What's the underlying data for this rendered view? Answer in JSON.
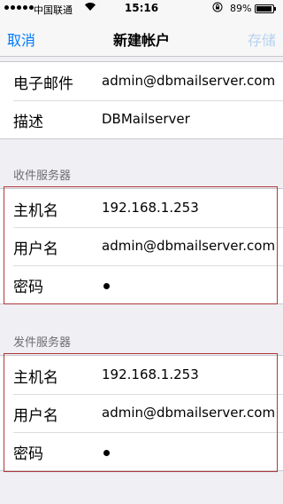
{
  "status_bar": {
    "carrier": "中国联通",
    "time": "15:16",
    "battery": "89%"
  },
  "nav": {
    "cancel": "取消",
    "title": "新建帐户",
    "save": "存储"
  },
  "account": {
    "email_label": "电子邮件",
    "email_value": "admin@dbmailserver.com",
    "description_label": "描述",
    "description_value": "DBMailserver"
  },
  "incoming": {
    "header": "收件服务器",
    "host_label": "主机名",
    "host_value": "192.168.1.253",
    "user_label": "用户名",
    "user_value": "admin@dbmailserver.com",
    "password_label": "密码"
  },
  "outgoing": {
    "header": "发件服务器",
    "host_label": "主机名",
    "host_value": "192.168.1.253",
    "user_label": "用户名",
    "user_value": "admin@dbmailserver.com",
    "password_label": "密码"
  },
  "colors": {
    "accent": "#007aff",
    "disabled": "#b7d2f1",
    "highlight": "#b0383b",
    "background": "#efeff4"
  }
}
